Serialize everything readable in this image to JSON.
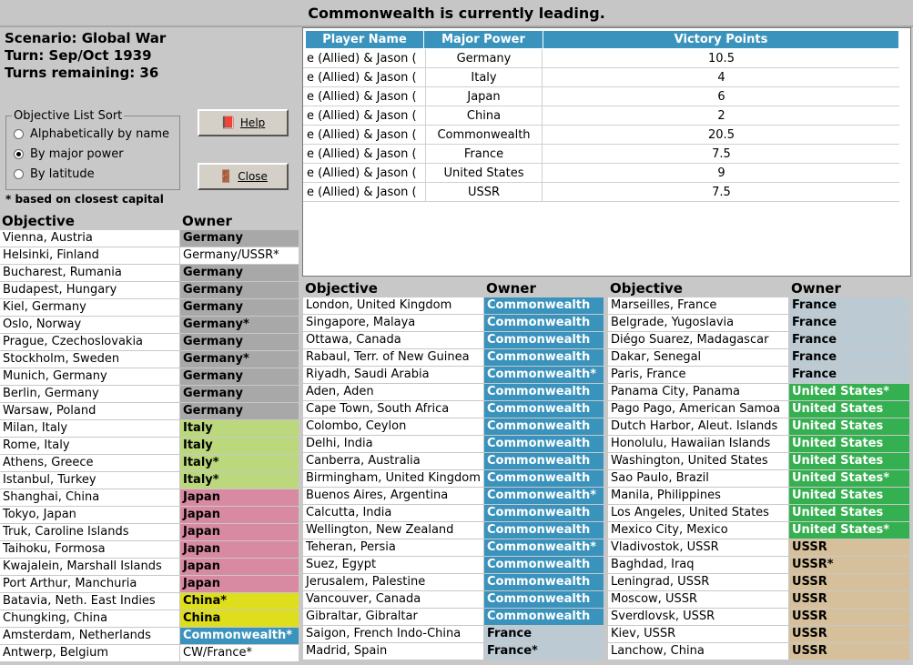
{
  "banner": "Commonwealth is currently leading.",
  "scenario": {
    "name": "Scenario: Global War",
    "turn": "Turn: Sep/Oct 1939",
    "remaining": "Turns remaining: 36"
  },
  "sort": {
    "legend": "Objective List Sort",
    "options": [
      "Alphabetically by name",
      "By major power",
      "By latitude"
    ],
    "selected": 1
  },
  "buttons": {
    "help": "Help",
    "close": "Close"
  },
  "note": "* based on closest capital",
  "colors": {
    "germany": "#a8a8a8",
    "italy": "#bcd87c",
    "japan": "#d98aa3",
    "china": "#dede1c",
    "commonwealth": "#3a93bd",
    "france": "#bccbd3",
    "us": "#35b050",
    "ussr": "#d6c09b",
    "plain": "#ffffff"
  },
  "victory": {
    "headers": [
      "Player Name",
      "Major Power",
      "Victory Points"
    ],
    "rows": [
      [
        "e (Allied) & Jason (",
        "Germany",
        "10.5"
      ],
      [
        "e (Allied) & Jason (",
        "Italy",
        "4"
      ],
      [
        "e (Allied) & Jason (",
        "Japan",
        "6"
      ],
      [
        "e (Allied) & Jason (",
        "China",
        "2"
      ],
      [
        "e (Allied) & Jason (",
        "Commonwealth",
        "20.5"
      ],
      [
        "e (Allied) & Jason (",
        "France",
        "7.5"
      ],
      [
        "e (Allied) & Jason (",
        "United States",
        "9"
      ],
      [
        "e (Allied) & Jason (",
        "USSR",
        "7.5"
      ]
    ]
  },
  "objectives": {
    "headers": {
      "objective": "Objective",
      "owner": "Owner"
    },
    "col1": [
      [
        "Vienna, Austria",
        "Germany",
        "germany"
      ],
      [
        "Helsinki, Finland",
        "Germany/USSR*",
        "plain"
      ],
      [
        "Bucharest, Rumania",
        "Germany",
        "germany"
      ],
      [
        "Budapest, Hungary",
        "Germany",
        "germany"
      ],
      [
        "Kiel, Germany",
        "Germany",
        "germany"
      ],
      [
        "Oslo, Norway",
        "Germany*",
        "germany"
      ],
      [
        "Prague, Czechoslovakia",
        "Germany",
        "germany"
      ],
      [
        "Stockholm, Sweden",
        "Germany*",
        "germany"
      ],
      [
        "Munich, Germany",
        "Germany",
        "germany"
      ],
      [
        "Berlin, Germany",
        "Germany",
        "germany"
      ],
      [
        "Warsaw, Poland",
        "Germany",
        "germany"
      ],
      [
        "Milan, Italy",
        "Italy",
        "italy"
      ],
      [
        "Rome, Italy",
        "Italy",
        "italy"
      ],
      [
        "Athens, Greece",
        "Italy*",
        "italy"
      ],
      [
        "Istanbul, Turkey",
        "Italy*",
        "italy"
      ],
      [
        "Shanghai, China",
        "Japan",
        "japan"
      ],
      [
        "Tokyo, Japan",
        "Japan",
        "japan"
      ],
      [
        "Truk, Caroline Islands",
        "Japan",
        "japan"
      ],
      [
        "Taihoku, Formosa",
        "Japan",
        "japan"
      ],
      [
        "Kwajalein, Marshall Islands",
        "Japan",
        "japan"
      ],
      [
        "Port Arthur, Manchuria",
        "Japan",
        "japan"
      ],
      [
        "Batavia, Neth. East Indies",
        "China*",
        "china"
      ],
      [
        "Chungking, China",
        "China",
        "china"
      ],
      [
        "Amsterdam, Netherlands",
        "Commonwealth*",
        "commonwealth"
      ],
      [
        "Antwerp, Belgium",
        "CW/France*",
        "plain"
      ]
    ],
    "col2": [
      [
        "London, United Kingdom",
        "Commonwealth",
        "commonwealth"
      ],
      [
        "Singapore, Malaya",
        "Commonwealth",
        "commonwealth"
      ],
      [
        "Ottawa, Canada",
        "Commonwealth",
        "commonwealth"
      ],
      [
        "Rabaul, Terr. of New Guinea",
        "Commonwealth",
        "commonwealth"
      ],
      [
        "Riyadh, Saudi Arabia",
        "Commonwealth*",
        "commonwealth"
      ],
      [
        "Aden, Aden",
        "Commonwealth",
        "commonwealth"
      ],
      [
        "Cape Town, South Africa",
        "Commonwealth",
        "commonwealth"
      ],
      [
        "Colombo, Ceylon",
        "Commonwealth",
        "commonwealth"
      ],
      [
        "Delhi, India",
        "Commonwealth",
        "commonwealth"
      ],
      [
        "Canberra, Australia",
        "Commonwealth",
        "commonwealth"
      ],
      [
        "Birmingham, United Kingdom",
        "Commonwealth",
        "commonwealth"
      ],
      [
        "Buenos Aires, Argentina",
        "Commonwealth*",
        "commonwealth"
      ],
      [
        "Calcutta, India",
        "Commonwealth",
        "commonwealth"
      ],
      [
        "Wellington, New Zealand",
        "Commonwealth",
        "commonwealth"
      ],
      [
        "Teheran, Persia",
        "Commonwealth*",
        "commonwealth"
      ],
      [
        "Suez, Egypt",
        "Commonwealth",
        "commonwealth"
      ],
      [
        "Jerusalem, Palestine",
        "Commonwealth",
        "commonwealth"
      ],
      [
        "Vancouver, Canada",
        "Commonwealth",
        "commonwealth"
      ],
      [
        "Gibraltar, Gibraltar",
        "Commonwealth",
        "commonwealth"
      ],
      [
        "Saigon, French Indo-China",
        "France",
        "france"
      ],
      [
        "Madrid, Spain",
        "France*",
        "france"
      ]
    ],
    "col3": [
      [
        "Marseilles, France",
        "France",
        "france"
      ],
      [
        "Belgrade, Yugoslavia",
        "France",
        "france"
      ],
      [
        "Diégo Suarez, Madagascar",
        "France",
        "france"
      ],
      [
        "Dakar, Senegal",
        "France",
        "france"
      ],
      [
        "Paris, France",
        "France",
        "france"
      ],
      [
        "Panama City, Panama",
        "United States*",
        "us"
      ],
      [
        "Pago Pago, American Samoa",
        "United States",
        "us"
      ],
      [
        "Dutch Harbor, Aleut. Islands",
        "United States",
        "us"
      ],
      [
        "Honolulu, Hawaiian Islands",
        "United States",
        "us"
      ],
      [
        "Washington, United States",
        "United States",
        "us"
      ],
      [
        "Sao Paulo, Brazil",
        "United States*",
        "us"
      ],
      [
        "Manila, Philippines",
        "United States",
        "us"
      ],
      [
        "Los Angeles, United States",
        "United States",
        "us"
      ],
      [
        "Mexico City, Mexico",
        "United States*",
        "us"
      ],
      [
        "Vladivostok, USSR",
        "USSR",
        "ussr"
      ],
      [
        "Baghdad, Iraq",
        "USSR*",
        "ussr"
      ],
      [
        "Leningrad, USSR",
        "USSR",
        "ussr"
      ],
      [
        "Moscow, USSR",
        "USSR",
        "ussr"
      ],
      [
        "Sverdlovsk, USSR",
        "USSR",
        "ussr"
      ],
      [
        "Kiev, USSR",
        "USSR",
        "ussr"
      ],
      [
        "Lanchow, China",
        "USSR",
        "ussr"
      ]
    ]
  }
}
